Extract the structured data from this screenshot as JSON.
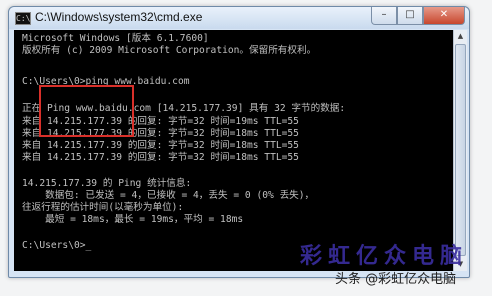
{
  "window": {
    "title": "C:\\Windows\\system32\\cmd.exe",
    "app_icon_glyph": "C:\\",
    "controls": {
      "minimize": "–",
      "maximize": "□",
      "close": "✕"
    }
  },
  "console": {
    "lines": [
      "Microsoft Windows [版本 6.1.7600]",
      "版权所有 (c) 2009 Microsoft Corporation。保留所有权利。",
      "",
      "C:\\Users\\0>ping www.baidu.com",
      "",
      "正在 Ping www.baidu.com [14.215.177.39] 具有 32 字节的数据:",
      "来自 14.215.177.39 的回复: 字节=32 时间=19ms TTL=55",
      "来自 14.215.177.39 的回复: 字节=32 时间=18ms TTL=55",
      "来自 14.215.177.39 的回复: 字节=32 时间=18ms TTL=55",
      "来自 14.215.177.39 的回复: 字节=32 时间=18ms TTL=55",
      "",
      "14.215.177.39 的 Ping 统计信息:",
      "    数据包: 已发送 = 4，已接收 = 4，丢失 = 0 (0% 丢失)，",
      "往返行程的估计时间(以毫秒为单位):",
      "    最短 = 18ms，最长 = 19ms，平均 = 18ms",
      "",
      "C:\\Users\\0>_"
    ]
  },
  "watermark": {
    "main": "彩虹亿众电脑",
    "sub": "头条 @彩虹亿众电脑"
  },
  "colors": {
    "console_bg": "#000000",
    "console_text": "#c0c0c0",
    "highlight_border": "#d9302a",
    "watermark": "#3a2ea0"
  }
}
